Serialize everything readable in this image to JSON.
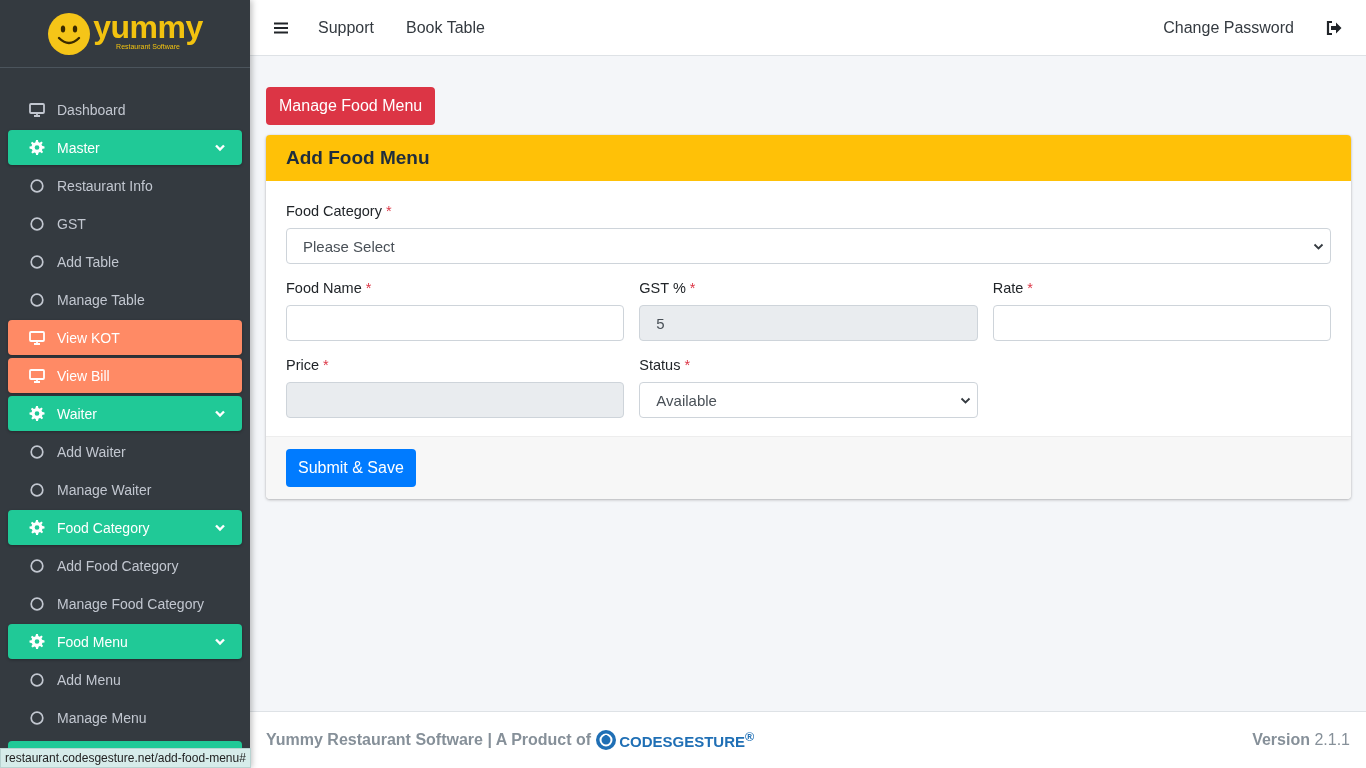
{
  "logo": {
    "wordmark": "yummy",
    "tagline": "Restaurant Software"
  },
  "sidebar": {
    "items": [
      {
        "kind": "link",
        "label": "Dashboard"
      },
      {
        "kind": "group",
        "label": "Master",
        "expanded": true,
        "children": [
          {
            "label": "Restaurant Info"
          },
          {
            "label": "GST"
          },
          {
            "label": "Add Table"
          },
          {
            "label": "Manage Table"
          }
        ]
      },
      {
        "kind": "highlight",
        "label": "View KOT"
      },
      {
        "kind": "highlight",
        "label": "View Bill"
      },
      {
        "kind": "group",
        "label": "Waiter",
        "expanded": true,
        "children": [
          {
            "label": "Add Waiter"
          },
          {
            "label": "Manage Waiter"
          }
        ]
      },
      {
        "kind": "group",
        "label": "Food Category",
        "expanded": true,
        "children": [
          {
            "label": "Add Food Category"
          },
          {
            "label": "Manage Food Category"
          }
        ]
      },
      {
        "kind": "group",
        "label": "Food Menu",
        "expanded": true,
        "children": [
          {
            "label": "Add Menu"
          },
          {
            "label": "Manage Menu"
          }
        ]
      }
    ],
    "more_below": true
  },
  "topbar": {
    "links": [
      "Support",
      "Book Table"
    ],
    "right_link": "Change Password"
  },
  "manage_button": "Manage Food Menu",
  "form": {
    "title": "Add Food Menu",
    "rows": [
      [
        {
          "kind": "select",
          "label": "Food Category",
          "required_mark": "*",
          "value": "Please Select",
          "disabled": false
        }
      ],
      [
        {
          "kind": "input",
          "label": "Food Name",
          "required_mark": "*",
          "disabled": false
        },
        {
          "kind": "input",
          "label": "GST %",
          "required_mark": "*",
          "value": "5",
          "disabled": true
        },
        {
          "kind": "input",
          "label": "Rate",
          "required_mark": "*",
          "disabled": false
        }
      ],
      [
        {
          "kind": "input",
          "label": "Price",
          "required_mark": "*",
          "disabled": true
        },
        {
          "kind": "select",
          "label": "Status",
          "required_mark": "*",
          "value": "Available",
          "disabled": false
        }
      ]
    ],
    "submit": "Submit & Save"
  },
  "footer": {
    "text": "Yummy Restaurant Software | A Product of",
    "brand": "CODESGESTURE$^{®}$",
    "version_label": "Version",
    "version": "2.1.1"
  },
  "status_url": "restaurant.codesgesture.net/add-food-menu#"
}
